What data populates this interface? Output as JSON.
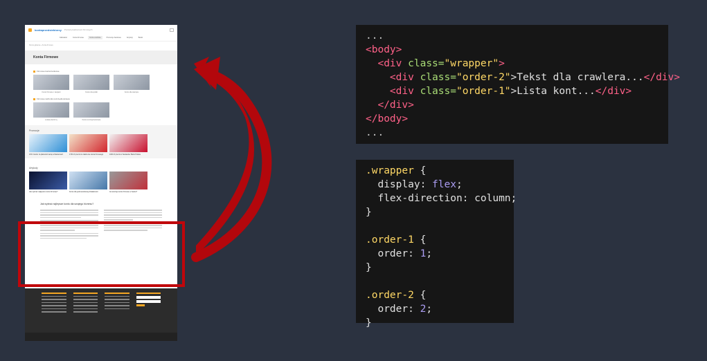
{
  "site": {
    "logo": "kontaprzedsiebiorcy",
    "tagline": "Porównywarka kont firmowych",
    "nav": [
      "Kalkulator",
      "Konta firmowe",
      "Konta osobiste",
      "Promocje bankowe",
      "Artykuły",
      "Banki"
    ],
    "breadcrumb": "Strona główna » Konta firmowe",
    "page_title": "Konta Firmowe",
    "section1_title": "Firmowe konta bankowe",
    "section1_cards": [
      "Konto firmowe z akcjami",
      "Konto dla spółki",
      "Konto dla startupu"
    ],
    "section2_title": "Firmowe rachunki oszczędnościowe",
    "section2_cards": [
      "Lokata dla firmy",
      "Konto oszczędnościowe"
    ],
    "promo_title": "Promocje",
    "promo_items": [
      "10% zwrotu za płatności kartą w Mastercard",
      "1700 zł premii za założenie konta firmowego",
      "1000 zł premii w Santander Bank Polska"
    ],
    "articles_title": "Artykuły",
    "articles": [
      "Jak wybrać najlepsze konto firmowe?",
      "Konto dla jednoosobowej działalności",
      "Ile kosztuje konto firmowe w banku?"
    ],
    "seo_heading": "Jak wybrać najlepsze konto dla swojego biznesu?"
  },
  "code_html": {
    "line1": "...",
    "body_open": "<body>",
    "wrapper_open_tag": "<div",
    "wrapper_class_attr": "class=",
    "wrapper_class_value": "\"wrapper\"",
    "wrapper_close_bracket": ">",
    "order2_open_tag": "<div",
    "order2_class_attr": "class=",
    "order2_class_value": "\"order-2\"",
    "order2_text": ">Tekst dla crawlera...",
    "order2_close": "</div>",
    "order1_open_tag": "<div",
    "order1_class_attr": "class=",
    "order1_class_value": "\"order-1\"",
    "order1_text": ">Lista kont...",
    "order1_close": "</div>",
    "wrapper_close": "</div>",
    "body_close": "</body>",
    "line_last": "..."
  },
  "code_css": {
    "wrapper_selector": ".wrapper",
    "open_brace": "{",
    "display_prop": "display:",
    "display_val": "flex",
    "flexdir_prop": "flex-direction:",
    "flexdir_val": "column;",
    "close_brace": "}",
    "order1_selector": ".order-1",
    "order_prop": "order:",
    "order1_val": "1",
    "order2_selector": ".order-2",
    "order2_val": "2"
  },
  "colors": {
    "background": "#2b3240",
    "highlight": "#c0060b",
    "accent": "#f5a623"
  }
}
